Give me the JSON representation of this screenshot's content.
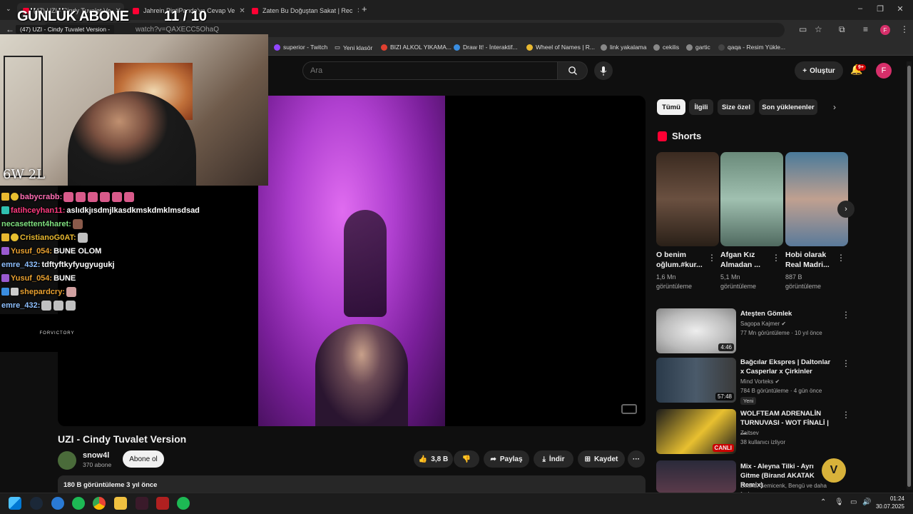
{
  "browser": {
    "tabs": [
      {
        "label": "(47) UZI - Cindy Tuvalet Ve",
        "active": true
      },
      {
        "label": "Jahrein PintiPanda'ya Cevap Ve"
      },
      {
        "label": "Zaten Bu Doğuştan Sakat | Rec"
      }
    ],
    "tab_hover_title": "(47) UZI - Cindy Tuvalet Version -",
    "url": "watch?v=QAXECC5OhaQ",
    "window_controls": [
      "–",
      "❐",
      "✕"
    ],
    "new_tab": "+",
    "bookmarks": [
      "superior - Twitch",
      "Yeni klasör",
      "BIZI ALKOL YIKAMA...",
      "Draw It! - İnteraktif...",
      "Wheel of Names | R...",
      "link yakalama",
      "cekilis",
      "gartic",
      "qaqa - Resim Yükle..."
    ]
  },
  "youtube": {
    "search_placeholder": "Ara",
    "create_label": "Oluştur",
    "notification_badge": "9+",
    "avatar_initial": "F",
    "video": {
      "title": "UZI - Cindy Tuvalet Version",
      "channel": "snow4l",
      "subscribers": "370 abone",
      "subscribe_label": "Abone ol",
      "likes": "3,8 B",
      "share_label": "Paylaş",
      "download_label": "İndir",
      "save_label": "Kaydet",
      "more": "···",
      "description_meta": "180 B görüntüleme  3 yıl önce"
    },
    "chips": [
      "Tümü",
      "İlgili",
      "Size özel",
      "Son yüklenenler"
    ],
    "shorts_header": "Shorts",
    "shorts": [
      {
        "title": "O benim oğlum.#kur...",
        "views": "1,6 Mn görüntüleme"
      },
      {
        "title": "Afgan Kız Almadan ...",
        "views": "5,1 Mn görüntüleme"
      },
      {
        "title": "Hobi olarak Real Madri...",
        "views": "887 B görüntüleme"
      }
    ],
    "related": [
      {
        "title": "Ateşten Gömlek",
        "channel": "Sagopa Kajmer",
        "meta": "77 Mn görüntüleme · 10 yıl önce",
        "duration": "4:46",
        "verified": true
      },
      {
        "title": "Bağcılar Ekspres | Daltonlar x Casperlar x Çirkinler",
        "channel": "Mind Vorteks",
        "meta": "784 B görüntüleme · 4 gün önce",
        "duration": "57:48",
        "badge": "Yeni",
        "verified": true
      },
      {
        "title": "WOLFTEAM ADRENALİN TURNUVASI - WOT FİNALİ | ...",
        "channel": "Zaitsev",
        "meta": "38 kullanıcı izliyor",
        "live": "CANLI"
      },
      {
        "title": "Mix - Aleyna Tilki - Ayrı Gitme (Birand AKATAK Remix)",
        "channel": "",
        "meta": "Birand, Semicenk, Bengü ve daha fazlası"
      }
    ]
  },
  "stream_overlay": {
    "title": "GÜNLÜK ABONE",
    "count": "11 / 10",
    "win_loss": "6W 2L",
    "brand": "FORVICTORY",
    "chat": [
      {
        "user": "babycrabb:",
        "color": "#ff6eb4",
        "message": ""
      },
      {
        "user": "fatihceyhan11:",
        "color": "#ff3b7f",
        "message": "aslıdkjısdmjlkasdkmskdmklmsdsad"
      },
      {
        "user": "necasettent4haret:",
        "color": "#7fe07f",
        "message": ""
      },
      {
        "user": "CristianoG0AT:",
        "color": "#e8b830",
        "message": ""
      },
      {
        "user": "Yusuf_054:",
        "color": "#e8a030",
        "message": "BUNE OLOM"
      },
      {
        "user": "emre_432:",
        "color": "#8fc0ff",
        "message": "tdftyftkyfyugyugukj"
      },
      {
        "user": "Yusuf_054:",
        "color": "#e8a030",
        "message": "BUNE"
      },
      {
        "user": "shepardcry:",
        "color": "#e8a030",
        "message": ""
      },
      {
        "user": "emre_432:",
        "color": "#8fc0ff",
        "message": ""
      }
    ]
  },
  "taskbar": {
    "time": "01:24",
    "date": "30.07.2025"
  },
  "colors": {
    "youtube_red": "#ff0033",
    "background": "#0f0f0f",
    "surface": "#272727"
  }
}
